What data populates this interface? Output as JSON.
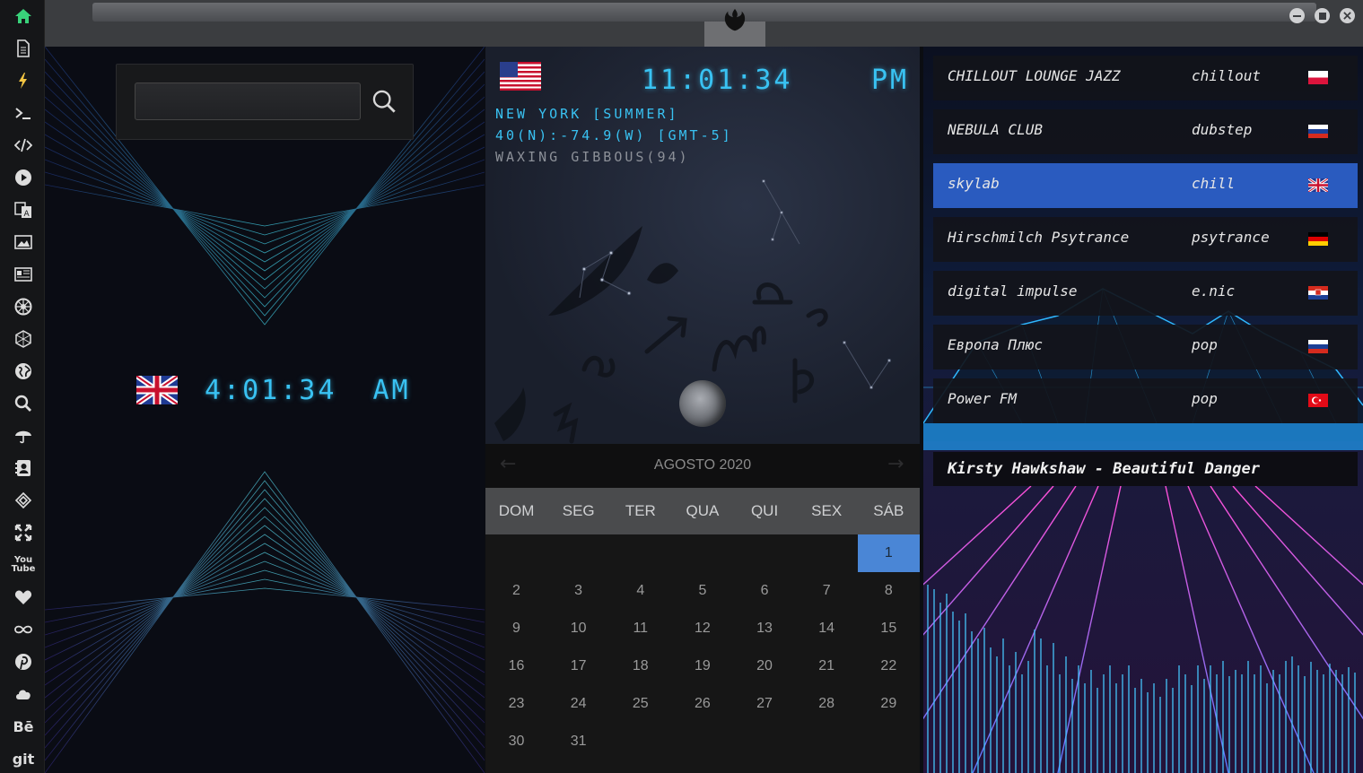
{
  "sidebar": {
    "items": [
      {
        "icon": "home-icon"
      },
      {
        "icon": "document-icon"
      },
      {
        "icon": "lightning-icon"
      },
      {
        "icon": "terminal-icon"
      },
      {
        "icon": "code-icon"
      },
      {
        "icon": "play-icon"
      },
      {
        "icon": "translate-icon"
      },
      {
        "icon": "image-icon"
      },
      {
        "icon": "news-icon"
      },
      {
        "icon": "rebel-icon"
      },
      {
        "icon": "empire-icon"
      },
      {
        "icon": "globe-icon"
      },
      {
        "icon": "search-icon"
      },
      {
        "icon": "umbrella-icon"
      },
      {
        "icon": "contact-icon"
      },
      {
        "icon": "codepen-icon"
      },
      {
        "icon": "expand-icon"
      },
      {
        "icon": "youtube-icon",
        "label": "You Tube"
      },
      {
        "icon": "heart-icon"
      },
      {
        "icon": "infinity-icon"
      },
      {
        "icon": "pinterest-icon"
      },
      {
        "icon": "cloud-icon"
      },
      {
        "icon": "behance-icon",
        "label": "Bē"
      },
      {
        "icon": "git-icon",
        "label": "git"
      }
    ]
  },
  "titlebar": {
    "logo": "rebel-alliance-icon",
    "buttons": [
      "minimize-icon",
      "maximize-icon",
      "close-icon"
    ]
  },
  "left_clock": {
    "flag": "uk-flag",
    "time": "4:01:34",
    "ampm": "AM"
  },
  "search": {
    "value": "",
    "icon": "search-icon"
  },
  "world_clock": {
    "flag": "us-flag",
    "time": "11:01:34",
    "ampm": "PM",
    "city": "NEW YORK [SUMMER]",
    "coords": "40(N):-74.9(W) [GMT-5]",
    "moon": "WAXING GIBBOUS(94)"
  },
  "calendar": {
    "title": "AGOSTO 2020",
    "prev": "←",
    "next": "→",
    "weekdays": [
      "DOM",
      "SEG",
      "TER",
      "QUA",
      "QUI",
      "SEX",
      "SÁB"
    ],
    "selected_day": "1",
    "days": [
      "1",
      "2",
      "3",
      "4",
      "5",
      "6",
      "7",
      "8",
      "9",
      "10",
      "11",
      "12",
      "13",
      "14",
      "15",
      "16",
      "17",
      "18",
      "19",
      "20",
      "21",
      "22",
      "23",
      "24",
      "25",
      "26",
      "27",
      "28",
      "29",
      "30",
      "31"
    ]
  },
  "radio": {
    "stations": [
      {
        "name": "CHILLOUT LOUNGE JAZZ",
        "genre": "chillout",
        "flag": "poland-flag"
      },
      {
        "name": "NEBULA CLUB",
        "genre": "dubstep",
        "flag": "russia-flag"
      },
      {
        "name": "skylab",
        "genre": "chill",
        "flag": "uk-flag",
        "active": true
      },
      {
        "name": "Hirschmilch Psytrance",
        "genre": "psytrance",
        "flag": "germany-flag"
      },
      {
        "name": "digital impulse",
        "genre": "e.nic",
        "flag": "croatia-flag"
      },
      {
        "name": "Европа Плюс",
        "genre": "pop",
        "flag": "russia-flag"
      },
      {
        "name": "Power FM",
        "genre": "pop",
        "flag": "turkey-flag"
      }
    ],
    "now_playing": "Kirsty Hawkshaw - Beautiful Danger"
  },
  "colors": {
    "accent": "#39c2f2",
    "selected_station": "#2a5bbf",
    "selected_day": "#4a86d6",
    "sidebar_home": "#39d27a"
  }
}
